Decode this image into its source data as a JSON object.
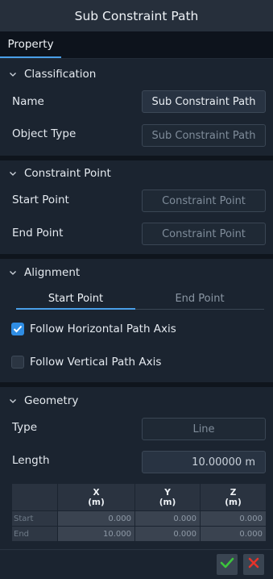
{
  "window": {
    "title": "Sub Constraint Path"
  },
  "tabs": {
    "property": "Property"
  },
  "classification": {
    "header": "Classification",
    "name_label": "Name",
    "name_value": "Sub Constraint Path",
    "object_type_label": "Object Type",
    "object_type_value": "Sub Constraint Path"
  },
  "constraint_point": {
    "header": "Constraint Point",
    "start_label": "Start Point",
    "start_value": "Constraint Point",
    "end_label": "End Point",
    "end_value": "Constraint Point"
  },
  "alignment": {
    "header": "Alignment",
    "tab_start": "Start Point",
    "tab_end": "End Point",
    "follow_horizontal": "Follow Horizontal Path Axis",
    "follow_horizontal_checked": true,
    "follow_vertical": "Follow Vertical Path Axis",
    "follow_vertical_checked": false
  },
  "geometry": {
    "header": "Geometry",
    "type_label": "Type",
    "type_value": "Line",
    "length_label": "Length",
    "length_value": "10.00000 m",
    "table": {
      "columns": [
        {
          "axis": "X",
          "unit": "(m)"
        },
        {
          "axis": "Y",
          "unit": "(m)"
        },
        {
          "axis": "Z",
          "unit": "(m)"
        }
      ],
      "rows": [
        {
          "label": "Start",
          "x": "0.000",
          "y": "0.000",
          "z": "0.000"
        },
        {
          "label": "End",
          "x": "10.000",
          "y": "0.000",
          "z": "0.000"
        }
      ]
    }
  },
  "icons": {
    "chevron": "chevron-down-icon",
    "check": "check-icon",
    "close": "close-icon"
  },
  "colors": {
    "accent": "#4a9fe8",
    "ok": "#3cc43c",
    "cancel": "#e5332a"
  }
}
